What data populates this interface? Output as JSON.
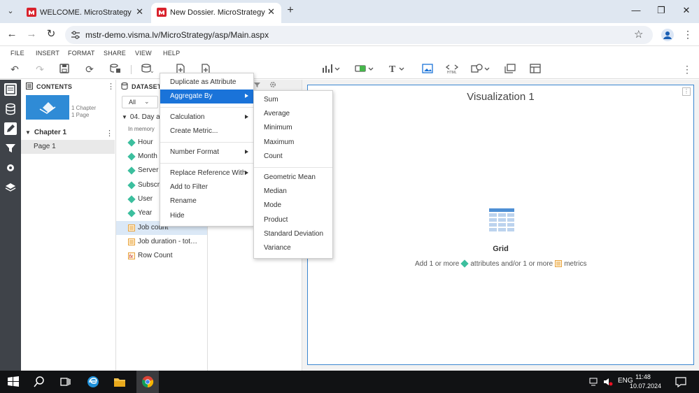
{
  "browser": {
    "tabs": [
      {
        "label": "WELCOME. MicroStrategy",
        "active": false
      },
      {
        "label": "New Dossier. MicroStrategy",
        "active": true
      }
    ],
    "url": "mstr-demo.visma.lv/MicroStrategy/asp/Main.aspx",
    "brand_color": "#d9232d"
  },
  "menubar": [
    "FILE",
    "INSERT",
    "FORMAT",
    "SHARE",
    "VIEW",
    "HELP"
  ],
  "contents_panel": {
    "title": "CONTENTS",
    "thumb_chapters": "1 Chapter",
    "thumb_pages": "1 Page",
    "chapter": "Chapter 1",
    "page": "Page 1"
  },
  "datasets_panel": {
    "title": "DATASETS",
    "filter_value": "All",
    "dataset_name": "04. Day ac",
    "dataset_mode": "In memory",
    "fields": [
      {
        "label": "Hour",
        "kind": "attribute"
      },
      {
        "label": "Month",
        "kind": "attribute"
      },
      {
        "label": "Server",
        "kind": "attribute"
      },
      {
        "label": "Subscri",
        "kind": "attribute"
      },
      {
        "label": "User",
        "kind": "attribute"
      },
      {
        "label": "Year",
        "kind": "attribute"
      },
      {
        "label": "Job count",
        "kind": "metric",
        "selected": true
      },
      {
        "label": "Job duration - tot…",
        "kind": "metric"
      },
      {
        "label": "Row Count",
        "kind": "derived-metric"
      }
    ]
  },
  "context_menu": [
    {
      "label": "Duplicate as Attribute"
    },
    {
      "label": "Aggregate By",
      "submenu": true,
      "highlighted": true
    },
    {
      "label": "Calculation",
      "submenu": true
    },
    {
      "label": "Create Metric..."
    },
    {
      "label": "Number Format",
      "submenu": true
    },
    {
      "label": "Replace Reference With",
      "submenu": true
    },
    {
      "label": "Add to Filter"
    },
    {
      "label": "Rename"
    },
    {
      "label": "Hide"
    }
  ],
  "aggregate_submenu": [
    "Sum",
    "Average",
    "Minimum",
    "Maximum",
    "Count",
    "Geometric Mean",
    "Median",
    "Mode",
    "Product",
    "Standard Deviation",
    "Variance"
  ],
  "visualization": {
    "title": "Visualization 1",
    "type_label": "Grid",
    "hint_prefix": "Add 1 or more",
    "hint_middle": "attributes and/or 1 or more",
    "hint_suffix": "metrics"
  },
  "taskbar": {
    "language": "ENG",
    "time": "11:48",
    "date": "10.07.2024"
  },
  "colors": {
    "accent": "#1a73d9",
    "attribute": "#3cbf9e",
    "metric": "#e8a33d",
    "rail": "#3f4349"
  }
}
